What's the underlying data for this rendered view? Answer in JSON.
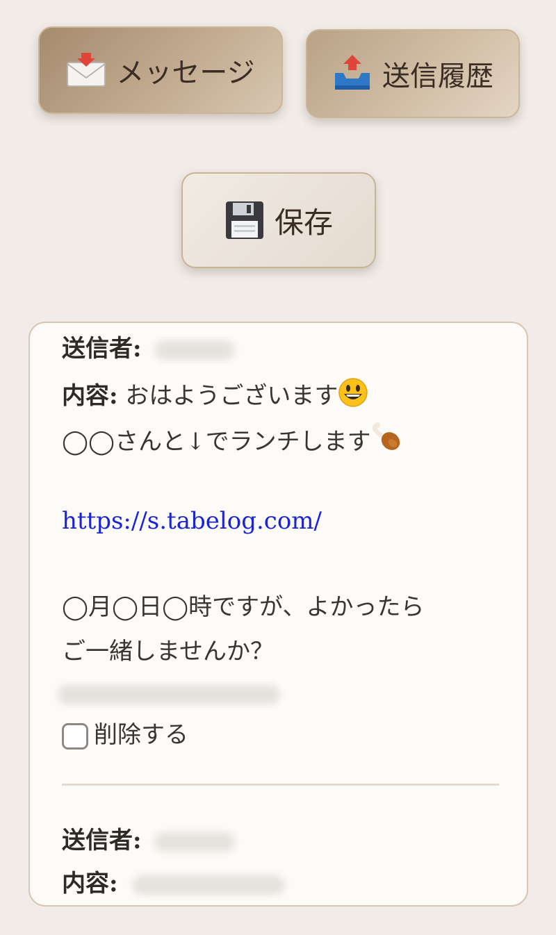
{
  "buttons": {
    "messages": {
      "label": "メッセージ",
      "icon": "incoming-envelope-icon"
    },
    "sent_history": {
      "label": "送信履歴",
      "icon": "outbox-tray-icon"
    },
    "save": {
      "label": "保存",
      "icon": "floppy-disk-icon"
    }
  },
  "messages": [
    {
      "sender_label": "送信者:",
      "content_label": "内容:",
      "content_line1": "おはようございます",
      "content_line2": "◯◯さんと↓でランチします",
      "link": "https://s.tabelog.com/",
      "content_line3": "◯月◯日◯時ですが、よかったら",
      "content_line4": "ご一緒しませんか？",
      "delete_label": "削除する"
    },
    {
      "sender_label": "送信者:",
      "content_label": "内容:"
    }
  ],
  "colors": {
    "background": "#f1ece8",
    "panel": "#fdfbf8",
    "link": "#1a24d6",
    "button_brown": "#a58b6e"
  }
}
